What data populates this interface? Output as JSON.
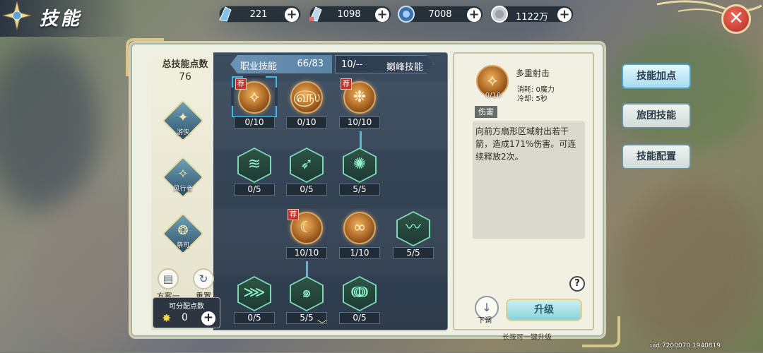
{
  "header": {
    "title": "技能",
    "resources": [
      {
        "icon": "blue-crystal-icon",
        "value": "221"
      },
      {
        "icon": "crystal-pen-icon",
        "value": "1098"
      },
      {
        "icon": "blue-badge-icon",
        "value": "7008"
      },
      {
        "icon": "silver-coin-icon",
        "value": "1122万"
      }
    ],
    "plus_label": "+",
    "close_label": "✕"
  },
  "left": {
    "total_label": "总技能点数",
    "total_value": "76",
    "classes": [
      {
        "label": "游侠",
        "icon": "ranger-class-icon"
      },
      {
        "label": "风行者",
        "icon": "windrunner-class-icon"
      },
      {
        "label": "祭司",
        "icon": "priest-class-icon"
      }
    ],
    "tools": [
      {
        "label": "方案一",
        "icon": "clipboard-icon"
      },
      {
        "label": "重置",
        "icon": "reset-icon"
      }
    ],
    "alloc_label": "可分配点数",
    "alloc_value": "0"
  },
  "tabs": {
    "job_label": "职业技能",
    "job_points": "66/83",
    "peak_points": "10/--",
    "peak_label": "巅峰技能"
  },
  "skills": [
    {
      "count": "0/10",
      "badge": "荐",
      "shape": "orb"
    },
    {
      "count": "0/10",
      "badge": "",
      "shape": "orb"
    },
    {
      "count": "10/10",
      "badge": "荐",
      "shape": "orb"
    },
    {
      "count": "0/5",
      "badge": "",
      "shape": "hex"
    },
    {
      "count": "0/5",
      "badge": "",
      "shape": "hex"
    },
    {
      "count": "5/5",
      "badge": "",
      "shape": "hex"
    },
    {
      "count": "10/10",
      "badge": "荐",
      "shape": "orb"
    },
    {
      "count": "1/10",
      "badge": "",
      "shape": "orb"
    },
    {
      "count": "5/5",
      "badge": "",
      "shape": "hex"
    },
    {
      "count": "0/5",
      "badge": "",
      "shape": "hex"
    },
    {
      "count": "5/5",
      "badge": "",
      "shape": "hex"
    },
    {
      "count": "0/5",
      "badge": "",
      "shape": "hex"
    }
  ],
  "detail": {
    "name": "多重射击",
    "level": "0/10",
    "cost_label": "消耗: 0魔力",
    "cooldown_label": "冷却: 5秒",
    "tag": "伤害",
    "description": "向前方扇形区域射出若干箭，造成171%伤害。可连续释放2次。",
    "help": "?",
    "down_label": "下调",
    "upgrade_label": "升级",
    "hint": "长按可一键升级"
  },
  "side_buttons": [
    {
      "label": "技能加点",
      "active": true
    },
    {
      "label": "旅团技能",
      "active": false
    },
    {
      "label": "技能配置",
      "active": false
    }
  ],
  "uid": "uid:7200070 1940819"
}
